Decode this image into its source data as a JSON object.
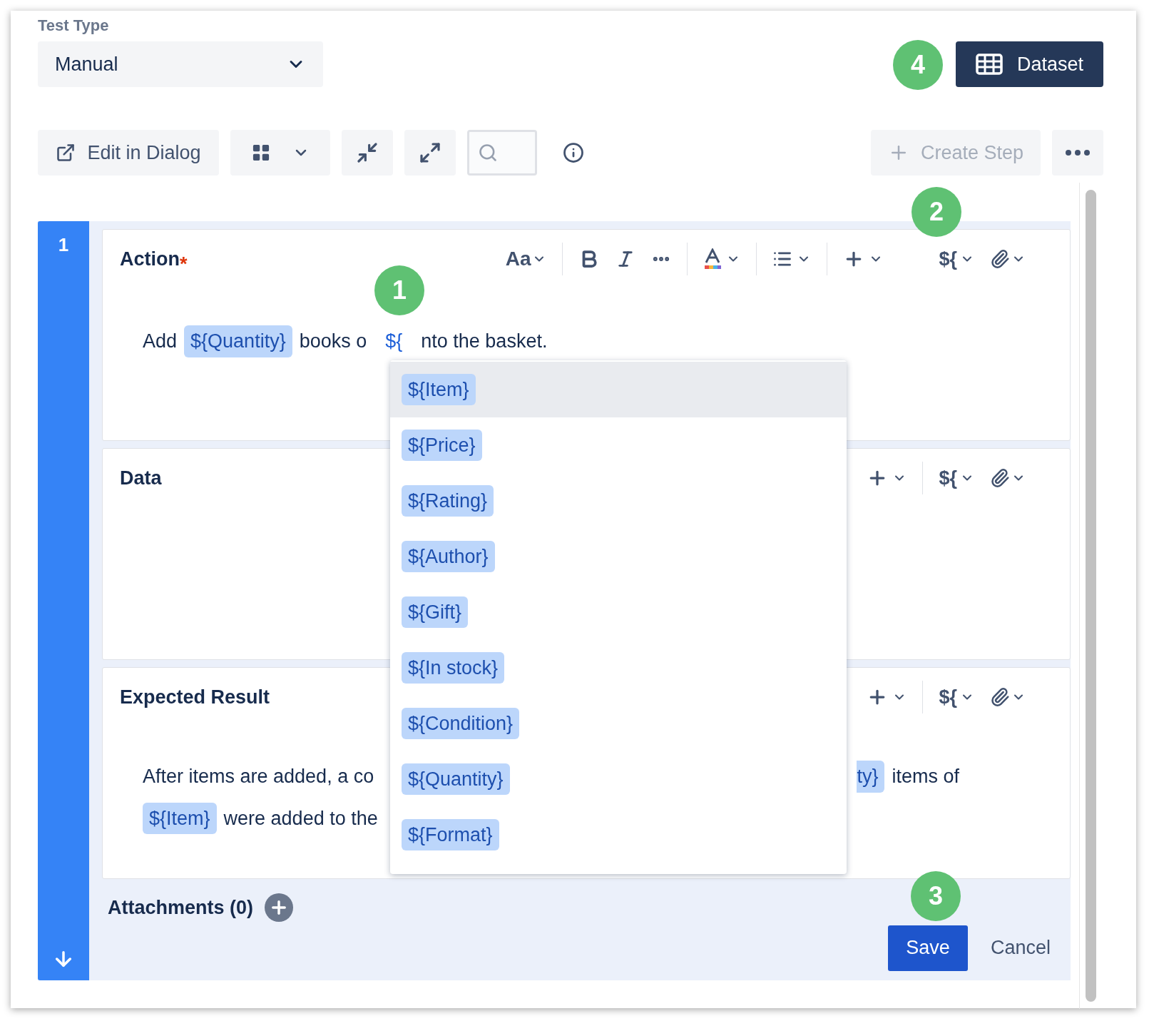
{
  "test_type": {
    "label": "Test Type",
    "value": "Manual"
  },
  "dataset_button": {
    "label": "Dataset"
  },
  "toolbar": {
    "edit_in_dialog": "Edit in Dialog",
    "create_step": {
      "label": "Create Step",
      "disabled": true
    }
  },
  "step": {
    "number": "1",
    "fields": [
      {
        "label": "Action",
        "required_mark": "*",
        "toolbar": {
          "kind": "full",
          "text_style": "Aa",
          "variable": "${"
        },
        "lines": [
          {
            "left": [
              {
                "kind": "text",
                "text": "Add"
              },
              {
                "kind": "chip",
                "text": "${Quantity}"
              },
              {
                "kind": "text",
                "text": "books o"
              },
              {
                "kind": "typing",
                "text": "${"
              },
              {
                "kind": "text",
                "text": "nto the basket."
              }
            ]
          }
        ]
      },
      {
        "label": "Data",
        "toolbar": {
          "kind": "partial",
          "variable": "${"
        }
      },
      {
        "label": "Expected Result",
        "toolbar": {
          "kind": "partial",
          "variable": "${"
        },
        "lines": [
          {
            "left": [
              {
                "kind": "text",
                "text": "After items are added, a co"
              }
            ],
            "right": [
              {
                "kind": "cut_chip",
                "text": "ty}"
              },
              {
                "kind": "text",
                "text": "items of"
              }
            ]
          },
          {
            "left": [
              {
                "kind": "chip",
                "text": "${Item}"
              },
              {
                "kind": "text",
                "text": "were added to the"
              }
            ]
          }
        ]
      }
    ],
    "attachments": "Attachments (0)",
    "save": "Save",
    "cancel": "Cancel"
  },
  "variable_menu": {
    "items": [
      {
        "text": "${Item}",
        "selected": true
      },
      {
        "text": "${Price}",
        "selected": false
      },
      {
        "text": "${Rating}",
        "selected": false
      },
      {
        "text": "${Author}",
        "selected": false
      },
      {
        "text": "${Gift}",
        "selected": false
      },
      {
        "text": "${In stock}",
        "selected": false
      },
      {
        "text": "${Condition}",
        "selected": false
      },
      {
        "text": "${Quantity}",
        "selected": false
      },
      {
        "text": "${Format}",
        "selected": false
      }
    ]
  },
  "callouts": [
    "1",
    "2",
    "3",
    "4"
  ]
}
